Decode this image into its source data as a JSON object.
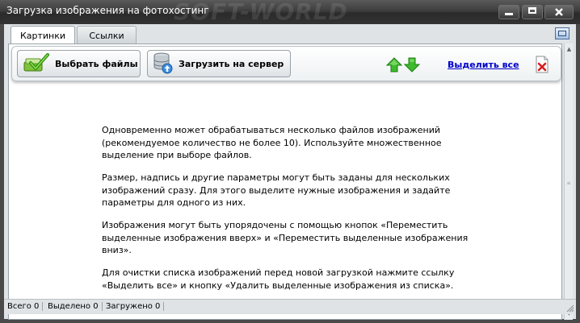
{
  "window": {
    "title": "Загрузка изображения на фотохостинг",
    "watermark": "SOFT-WORLD"
  },
  "tabs": [
    {
      "label": "Картинки",
      "active": true
    },
    {
      "label": "Ссылки",
      "active": false
    }
  ],
  "toolbar": {
    "select_files_label": "Выбрать файлы",
    "upload_label": "Загрузить на сервер",
    "select_all_label": "Выделить все"
  },
  "info": {
    "paragraphs": [
      "Одновременно может обрабатываться несколько файлов изображений (рекомендуемое количество не более 10). Используйте множественное выделение при выборе файлов.",
      "Размер, надпись и другие параметры могут быть заданы для нескольких изображений сразу. Для этого выделите нужные изображения и задайте параметры для одного из них.",
      "Изображения могут быть упорядочены с помощью кнопок «Переместить выделенные изображения вверх» и «Переместить выделенные изображения вниз».",
      "Для очистки списка изображений перед новой загрузкой нажмите ссылку «Выделить все» и кнопку «Удалить выделенные изображения из списка»."
    ]
  },
  "status": {
    "total": "Всего 0",
    "selected": "Выделено 0",
    "uploaded": "Загружено 0"
  },
  "colors": {
    "link": "#0000cc",
    "arrow_green": "#3dbb2c",
    "delete_red": "#d42020"
  },
  "icons": {
    "select_files": "green-check-icon",
    "upload": "database-upload-icon",
    "move_up": "green-arrow-up-icon",
    "move_down": "green-arrow-down-icon",
    "delete": "delete-document-icon",
    "restore": "window-restore-icon"
  }
}
